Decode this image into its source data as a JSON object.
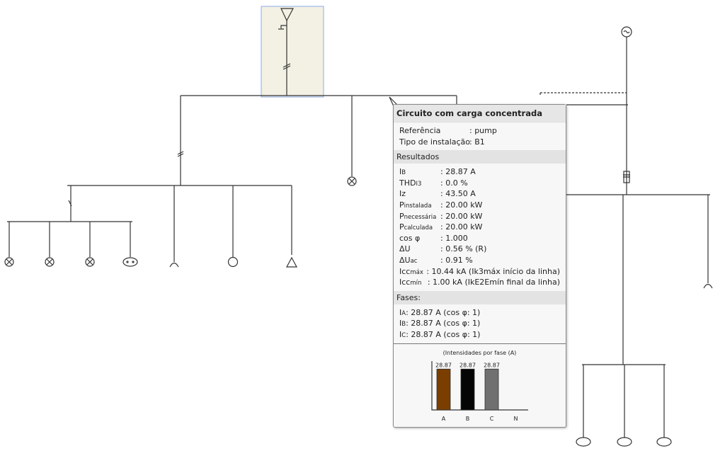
{
  "tooltip": {
    "title": "Circuito com carga concentrada",
    "info": [
      {
        "label": "Referência",
        "value": ": pump"
      },
      {
        "label": "Tipo de instalação",
        "value": ": B1"
      }
    ],
    "results_header": "Resultados",
    "results": [
      {
        "main": "I",
        "sub": "B",
        "value": ": 28.87 A"
      },
      {
        "main": "THD",
        "sub": "I3",
        "value": ": 0.0 %"
      },
      {
        "main": "Iz",
        "sub": "",
        "value": ": 43.50 A"
      },
      {
        "main": "P",
        "sub": "instalada",
        "value": ": 20.00 kW"
      },
      {
        "main": "P",
        "sub": "necessária",
        "value": ": 20.00 kW"
      },
      {
        "main": "P",
        "sub": "calculada",
        "value": ": 20.00 kW"
      },
      {
        "main": "cos φ",
        "sub": "",
        "value": ": 1.000"
      },
      {
        "main": "ΔU",
        "sub": "",
        "value": ": 0.56 % (R)"
      },
      {
        "main": "ΔU",
        "sub": "ac",
        "value": ": 0.91 %"
      },
      {
        "main": "Icc",
        "sub": "máx",
        "value": ": 10.44 kA (Ik3máx início da linha)"
      },
      {
        "main": "Icc",
        "sub": "mín",
        "value": ": 1.00 kA (IkE2Emín final da linha)"
      }
    ],
    "phases_header": "Fases:",
    "phases": [
      {
        "main": "I",
        "sub": "A",
        "value": " : 28.87 A (cos φ: 1)"
      },
      {
        "main": "I",
        "sub": "B",
        "value": " : 28.87 A (cos φ: 1)"
      },
      {
        "main": "I",
        "sub": "C",
        "value": " : 28.87 A (cos φ: 1)"
      }
    ]
  },
  "chart_data": {
    "type": "bar",
    "title": "(Intensidades por fase (A)",
    "categories": [
      "A",
      "B",
      "C",
      "N"
    ],
    "values": [
      28.87,
      28.87,
      28.87,
      0
    ],
    "labels": [
      "28.87",
      "28.87",
      "28.87",
      ""
    ],
    "colors": [
      "#7a3e00",
      "#050505",
      "#707070",
      "#cccccc"
    ],
    "ylim": [
      0,
      35
    ]
  }
}
